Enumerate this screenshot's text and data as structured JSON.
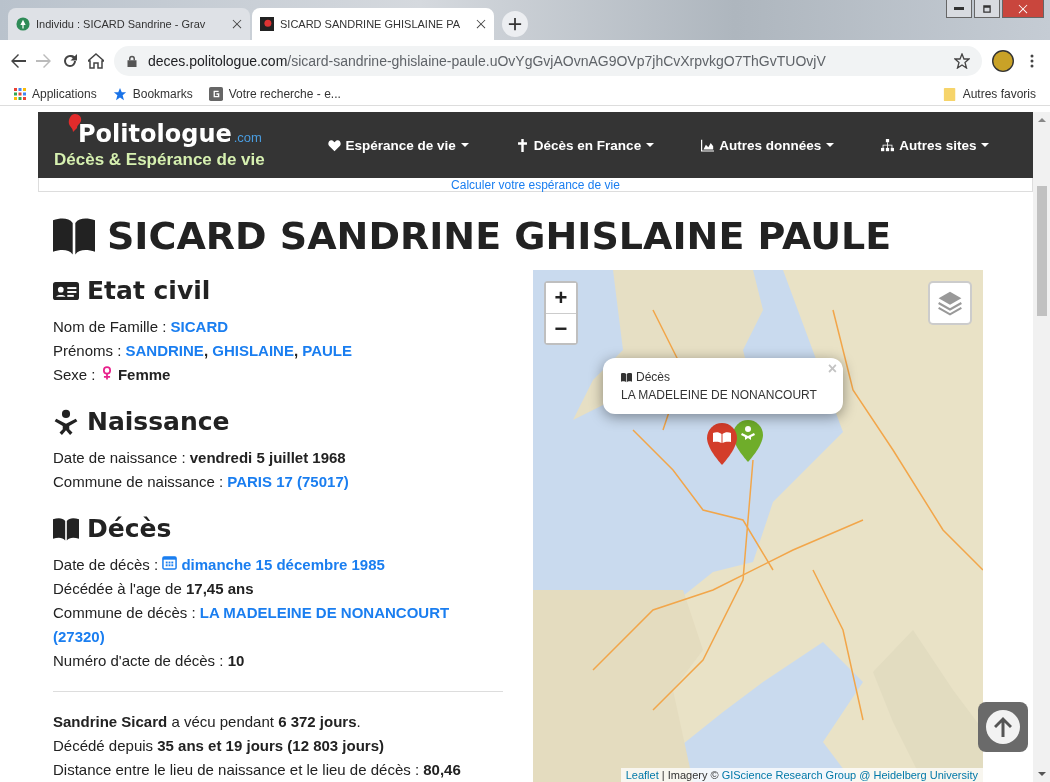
{
  "browser": {
    "tabs": [
      {
        "title": "Individu : SICARD Sandrine - Grav",
        "selected": false
      },
      {
        "title": "SICARD SANDRINE GHISLAINE PA",
        "selected": true
      }
    ],
    "url": {
      "host": "deces.politologue.com",
      "path": "/sicard-sandrine-ghislaine-paule.uOvYgGvjAOvnAG9OVp7jhCvXrpvkgO7ThGvTUOvjV"
    },
    "bookmarks": [
      "Applications",
      "Bookmarks",
      "Votre recherche - e..."
    ],
    "other_bookmarks": "Autres favoris"
  },
  "navbar": {
    "logo": "Politologue",
    "logo_suffix": ".com",
    "tagline": "Décès & Espérance de vie",
    "menu": [
      {
        "label": "Espérance de vie",
        "kind": "heart"
      },
      {
        "label": "Décès en France",
        "kind": "cross"
      },
      {
        "label": "Autres données",
        "kind": "chart"
      },
      {
        "label": "Autres sites",
        "kind": "sitemap"
      }
    ]
  },
  "banner": "Calculer votre espérance de vie",
  "title": "SICARD SANDRINE GHISLAINE PAULE",
  "sections": [
    {
      "title": "Etat civil",
      "kind": "id",
      "rows": [
        [
          {
            "text": "Nom de Famille : ",
            "kind": "label"
          },
          {
            "text": "SICARD",
            "kind": "link"
          }
        ],
        [
          {
            "text": "Prénoms : ",
            "kind": "label"
          },
          {
            "text": "SANDRINE",
            "kind": "link"
          },
          {
            "text": ", ",
            "kind": "value"
          },
          {
            "text": "GHISLAINE",
            "kind": "link"
          },
          {
            "text": ", ",
            "kind": "value"
          },
          {
            "text": "PAULE",
            "kind": "link"
          }
        ],
        [
          {
            "text": "Sexe : ",
            "kind": "label"
          },
          {
            "text": "Femme",
            "kind": "female"
          }
        ]
      ]
    },
    {
      "title": "Naissance",
      "kind": "baby",
      "rows": [
        [
          {
            "text": "Date de naissance : ",
            "kind": "label"
          },
          {
            "text": "vendredi 5 juillet 1968",
            "kind": "value"
          }
        ],
        [
          {
            "text": "Commune de naissance : ",
            "kind": "label"
          },
          {
            "text": "PARIS 17 (75017)",
            "kind": "link"
          }
        ]
      ]
    },
    {
      "title": "Décès",
      "kind": "book",
      "rows": [
        [
          {
            "text": "Date de décès : ",
            "kind": "label"
          },
          {
            "text": "dimanche 15 décembre 1985",
            "kind": "date"
          }
        ],
        [
          {
            "text": "Décédée à l'age de ",
            "kind": "label"
          },
          {
            "text": "17,45 ans",
            "kind": "value"
          }
        ],
        [
          {
            "text": "Commune de décès : ",
            "kind": "label"
          },
          {
            "text": "LA MADELEINE DE NONANCOURT",
            "kind": "link"
          },
          {
            "text": "(27320)",
            "kind": "link-line"
          }
        ],
        [
          {
            "text": "Numéro d'acte de décès : ",
            "kind": "label"
          },
          {
            "text": "10",
            "kind": "value"
          }
        ]
      ]
    }
  ],
  "summary": [
    "**Sandrine Sicard** a vécu pendant **6 372 jours**.",
    "Décédé depuis **35 ans et 19 jours (12 803 jours)**",
    "Distance entre le lieu de naissance et le lieu de décès : **80,46**"
  ],
  "map": {
    "zoom_in": "+",
    "zoom_out": "−",
    "popup": {
      "title": "Décès",
      "place": "LA MADELEINE DE NONANCOURT",
      "close": "×"
    },
    "attribution": [
      {
        "text": "Leaflet",
        "kind": "link"
      },
      {
        "text": " | Imagery © ",
        "kind": "text"
      },
      {
        "text": "GIScience Research Group @ Heidelberg University",
        "kind": "link"
      }
    ]
  }
}
